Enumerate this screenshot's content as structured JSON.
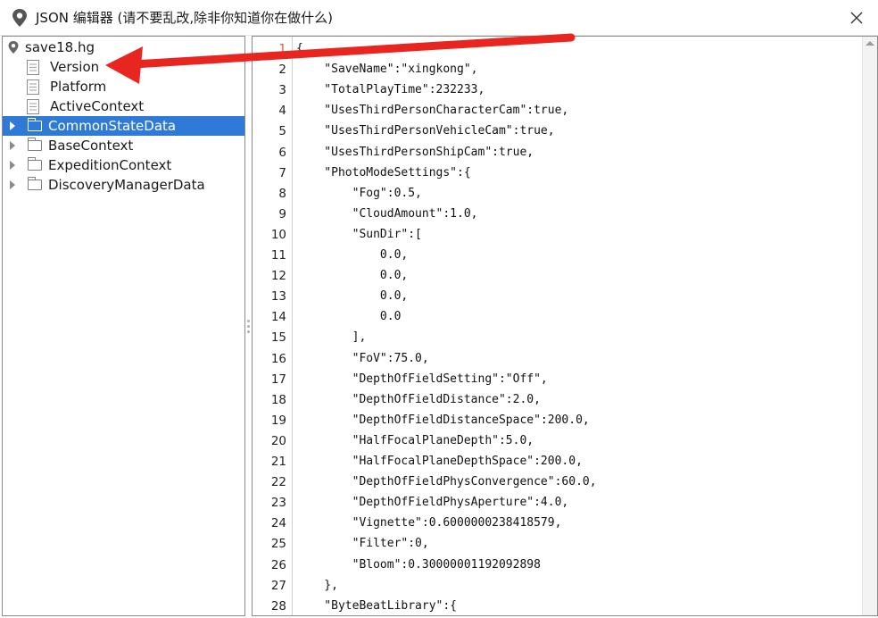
{
  "window": {
    "title": "JSON 编辑器 (请不要乱改,除非你知道你在做什么)",
    "app_icon": "location-pin-icon",
    "close_icon": "close-icon"
  },
  "tree": {
    "root": "save18.hg",
    "items": [
      {
        "label": "Version",
        "kind": "leaf"
      },
      {
        "label": "Platform",
        "kind": "leaf"
      },
      {
        "label": "ActiveContext",
        "kind": "leaf"
      },
      {
        "label": "CommonStateData",
        "kind": "folder",
        "selected": true
      },
      {
        "label": "BaseContext",
        "kind": "folder"
      },
      {
        "label": "ExpeditionContext",
        "kind": "folder"
      },
      {
        "label": "DiscoveryManagerData",
        "kind": "folder"
      }
    ]
  },
  "editor": {
    "current_line": 1,
    "lines": [
      "{",
      "    \"SaveName\":\"xingkong\",",
      "    \"TotalPlayTime\":232233,",
      "    \"UsesThirdPersonCharacterCam\":true,",
      "    \"UsesThirdPersonVehicleCam\":true,",
      "    \"UsesThirdPersonShipCam\":true,",
      "    \"PhotoModeSettings\":{",
      "        \"Fog\":0.5,",
      "        \"CloudAmount\":1.0,",
      "        \"SunDir\":[",
      "            0.0,",
      "            0.0,",
      "            0.0,",
      "            0.0",
      "        ],",
      "        \"FoV\":75.0,",
      "        \"DepthOfFieldSetting\":\"Off\",",
      "        \"DepthOfFieldDistance\":2.0,",
      "        \"DepthOfFieldDistanceSpace\":200.0,",
      "        \"HalfFocalPlaneDepth\":5.0,",
      "        \"HalfFocalPlaneDepthSpace\":200.0,",
      "        \"DepthOfFieldPhysConvergence\":60.0,",
      "        \"DepthOfFieldPhysAperture\":4.0,",
      "        \"Vignette\":0.6000000238418579,",
      "        \"Filter\":0,",
      "        \"Bloom\":0.30000001192092898",
      "    },",
      "    \"ByteBeatLibrary\":{"
    ]
  },
  "annotation": {
    "color": "#e8251f",
    "icon": "red-arrow-annotation"
  }
}
